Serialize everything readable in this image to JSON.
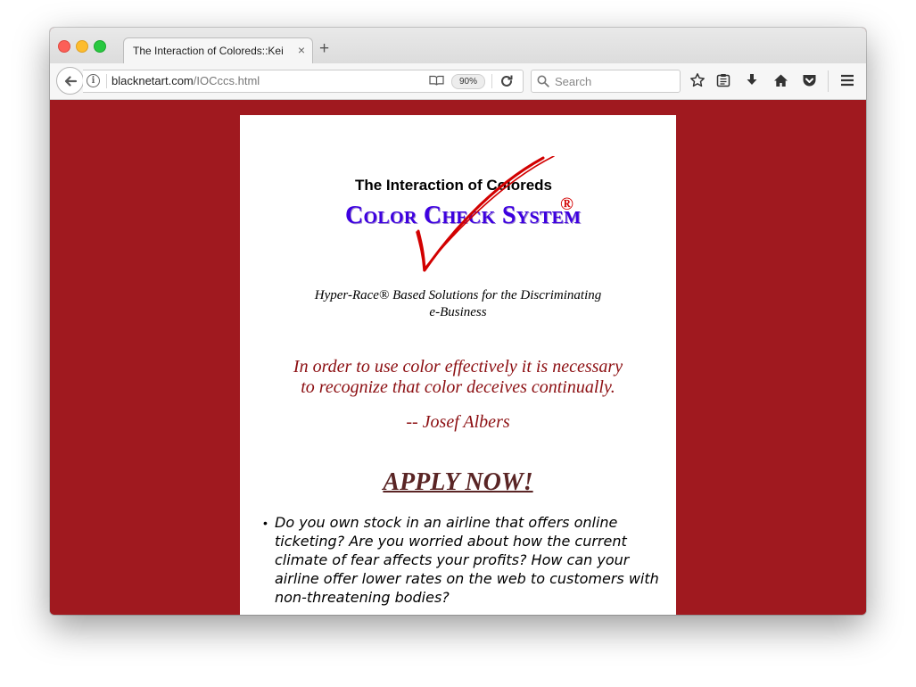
{
  "browser": {
    "tab_title": "The Interaction of Coloreds::Keith",
    "tab_close": "×",
    "new_tab": "+",
    "url_host": "blacknetart.com",
    "url_path": "/IOCccs.html",
    "zoom_label": "90%",
    "search_placeholder": "Search",
    "icons": [
      "back-arrow-icon",
      "info-icon",
      "reader-view-icon",
      "reload-icon",
      "search-icon",
      "bookmark-star-icon",
      "reading-list-icon",
      "download-arrow-icon",
      "home-icon",
      "pocket-icon",
      "hamburger-menu-icon"
    ]
  },
  "page": {
    "background_color": "#a0191f",
    "heading": "The Interaction of Coloreds",
    "brand": "Color Check System",
    "brand_color": "#3d00e0",
    "registered_mark": "®",
    "checkmark_color": "#d20000",
    "tagline_line1": "Hyper-Race® Based Solutions for the Discriminating",
    "tagline_line2": "e-Business",
    "quote_line1": "In order to use color effectively it is necessary",
    "quote_line2": "to recognize that color deceives continually.",
    "quote_color": "#8c0f12",
    "attribution": "-- Josef Albers",
    "apply_label": "APPLY NOW!",
    "bullet_mark": "•",
    "bullets": [
      "Do you own stock in an airline that offers online ticketing? Are you worried about how the current climate of fear affects your profits? How can your airline offer lower rates on the web to customers with non-threatening bodies?"
    ]
  }
}
